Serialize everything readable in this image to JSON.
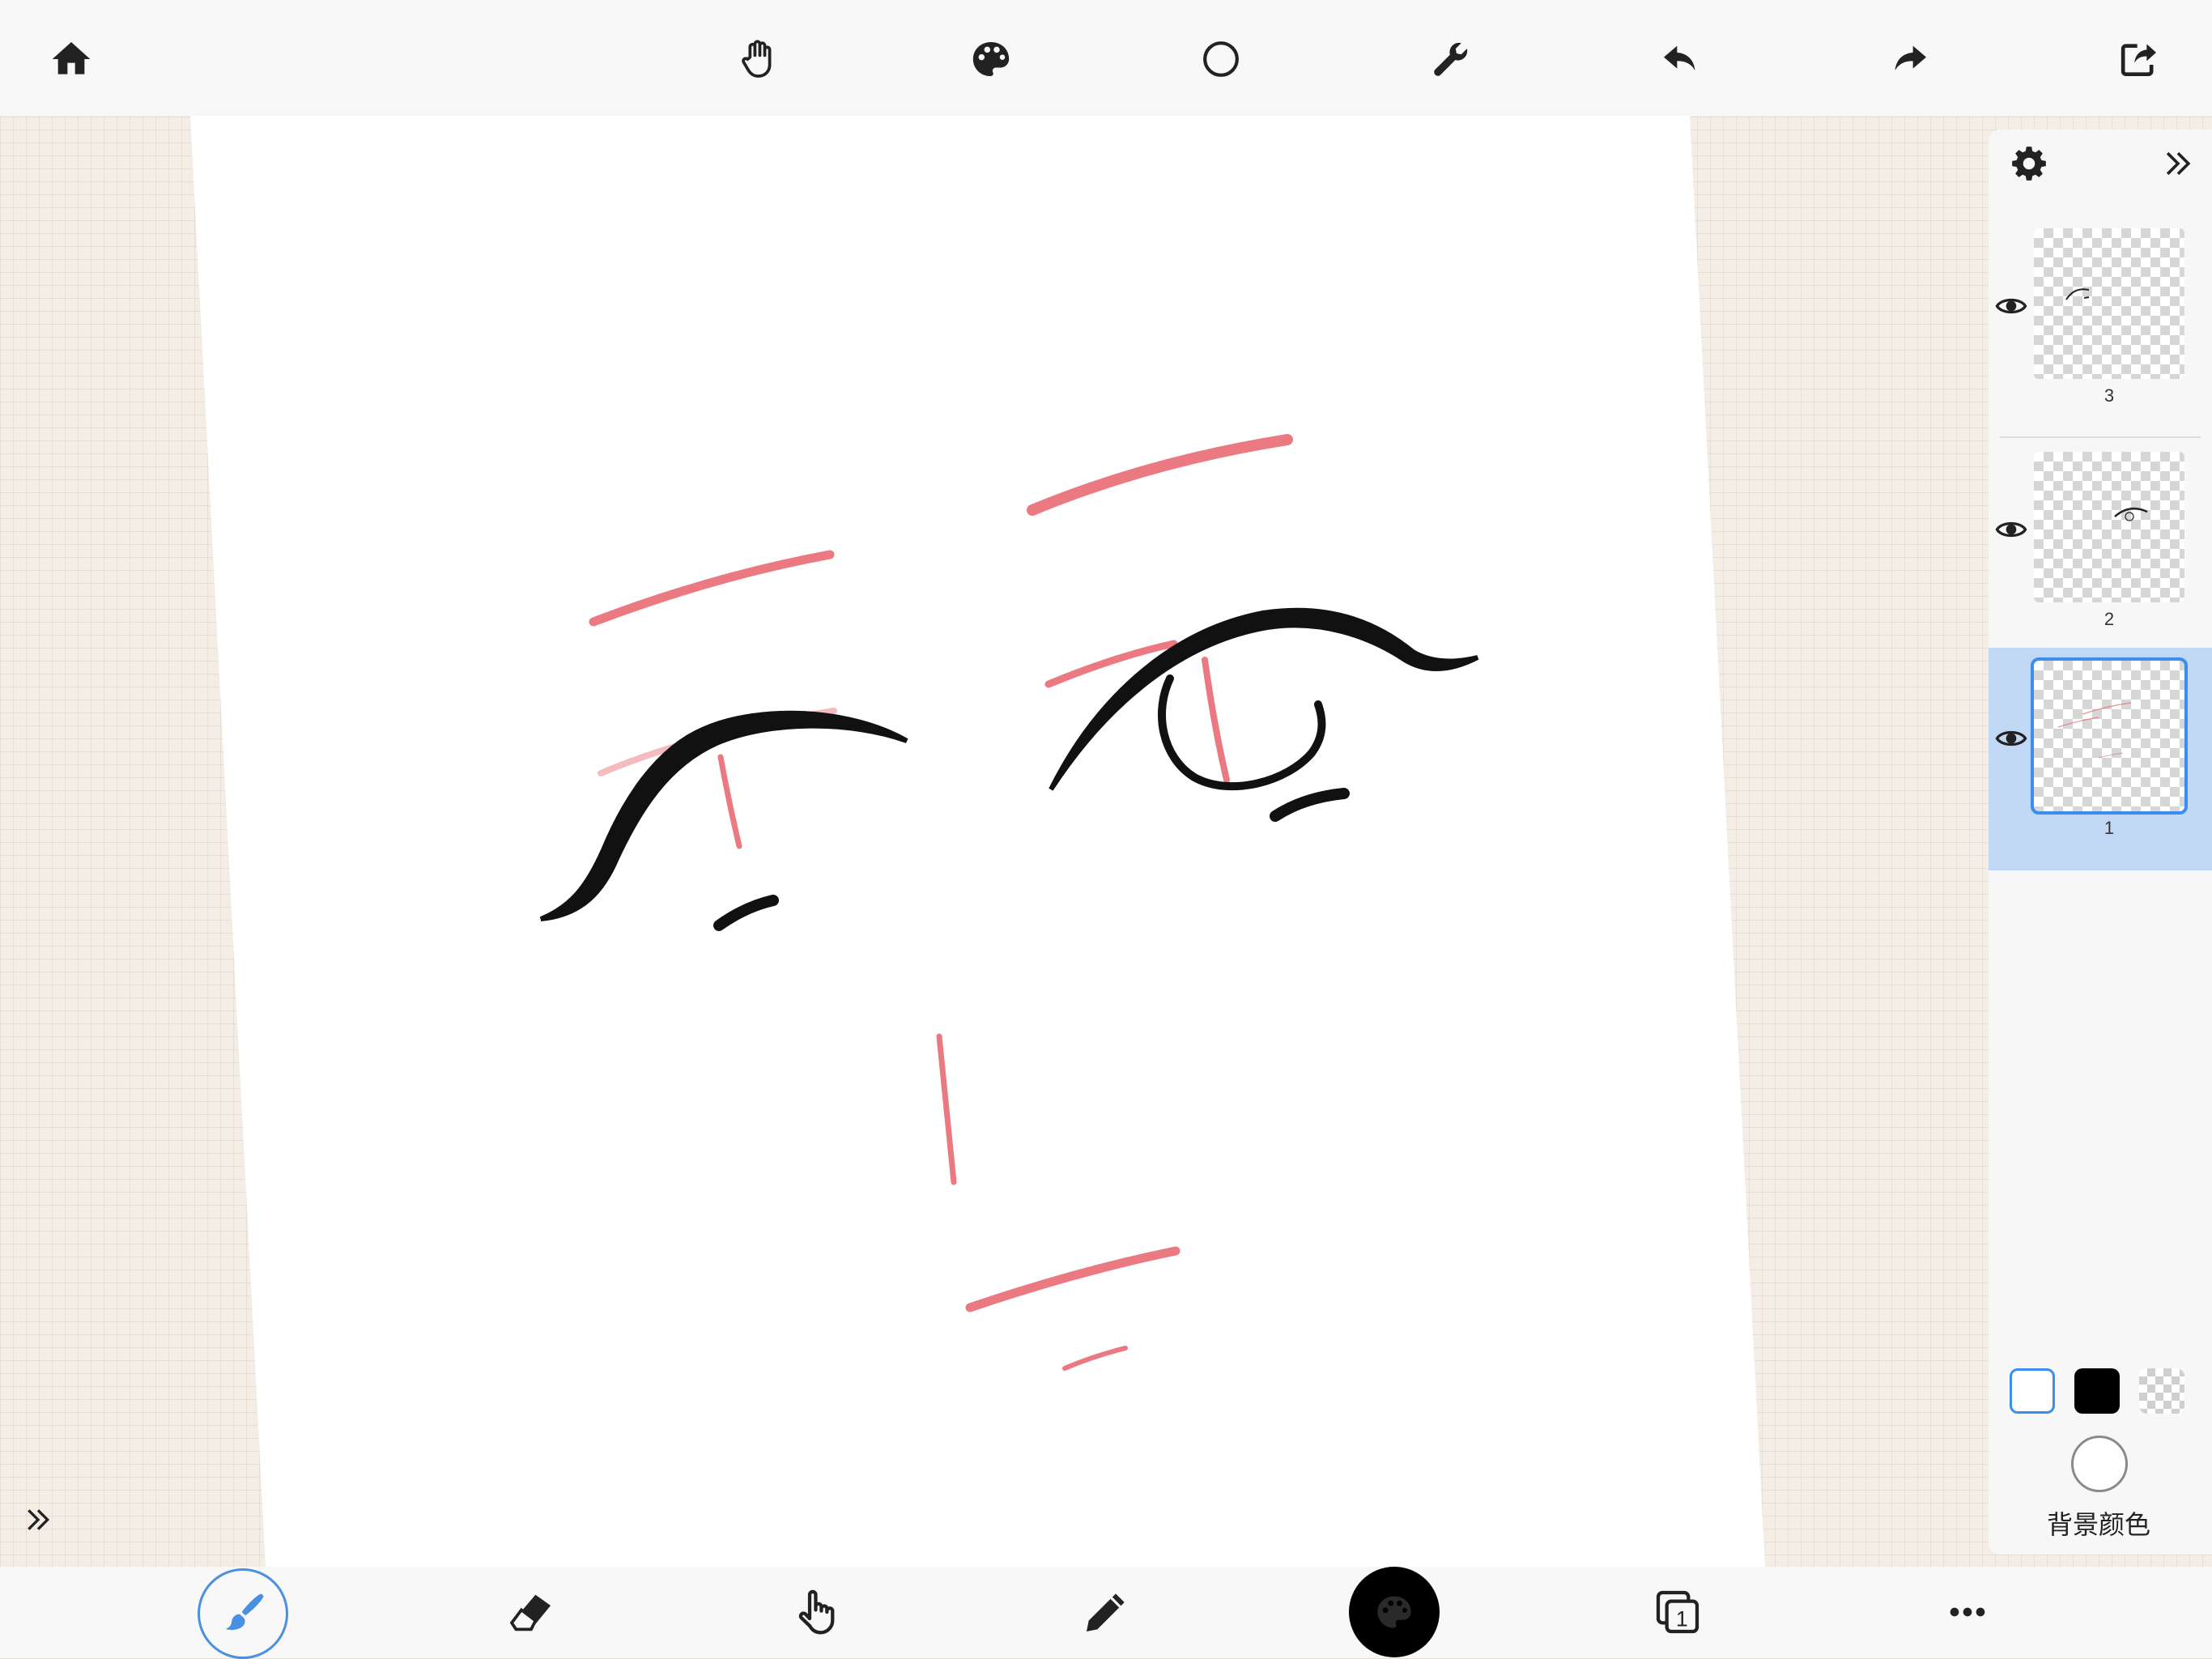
{
  "toolbar": {
    "icons": [
      "home-icon",
      "hand-icon",
      "palette-icon",
      "circle-icon",
      "wrench-icon",
      "undo-icon",
      "redo-icon",
      "share-icon"
    ]
  },
  "layers_panel": {
    "icons": [
      "gear-icon",
      "collapse-right-icon"
    ],
    "layers": [
      {
        "number": "3",
        "visible": true,
        "selected": false
      },
      {
        "number": "2",
        "visible": true,
        "selected": false
      },
      {
        "number": "1",
        "visible": true,
        "selected": true
      }
    ],
    "swatch_colors": [
      "#ffffff",
      "#000000",
      "transparent"
    ],
    "background_color": "#ffffff",
    "background_label": "背景颜色"
  },
  "bottom_toolbar": {
    "icons": [
      "brush-icon",
      "eraser-icon",
      "finger-smudge-icon",
      "pencil-icon",
      "color-palette-icon",
      "layers-icon",
      "more-icon"
    ],
    "layers_count": "1",
    "active_tool": "brush-icon",
    "accent_color": "#4a90e2"
  },
  "colors": {
    "sketch_red": "#e8616b",
    "ink_black": "#111111",
    "selection_blue": "#c0d8f4"
  }
}
